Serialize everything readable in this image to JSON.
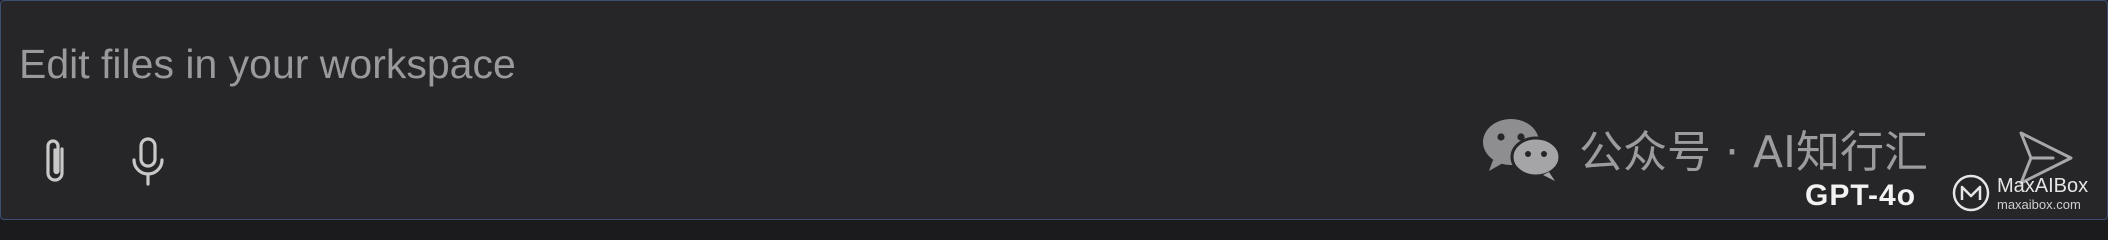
{
  "input": {
    "placeholder": "Edit files in your workspace",
    "value": ""
  },
  "toolbar": {
    "attach_icon": "paperclip-icon",
    "mic_icon": "microphone-icon",
    "send_icon": "send-icon"
  },
  "model": {
    "selected": "GPT-4o"
  },
  "watermark": {
    "text": "公众号 · AI知行汇",
    "icon": "wechat-icon"
  },
  "badge": {
    "name": "MaxAIBox",
    "url": "maxaibox.com"
  },
  "colors": {
    "background": "#262628",
    "border": "#3c4f72",
    "placeholder": "#9a9a9c",
    "icon": "#c8c8c8"
  }
}
